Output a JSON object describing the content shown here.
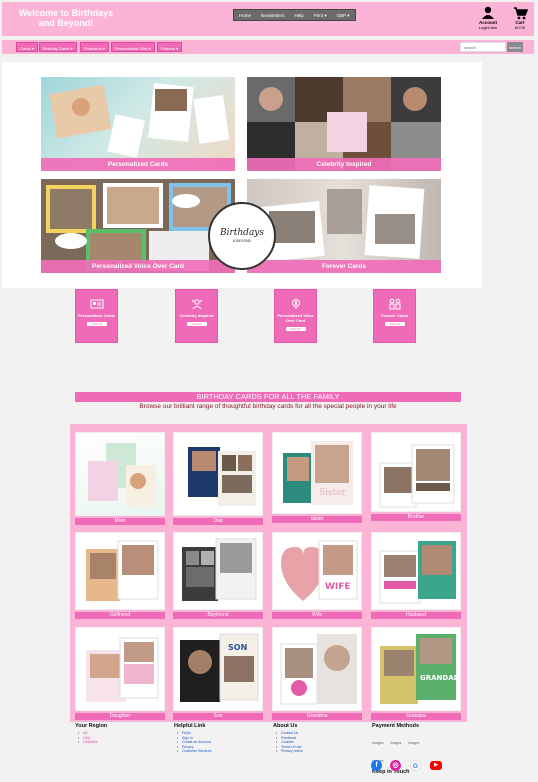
{
  "header": {
    "welcome": "Welcome to Birthdays and Beyond!",
    "topnav": [
      "Home",
      "Newsletters",
      "Help",
      "Print",
      "GBP"
    ],
    "account_label": "Account",
    "account_sub": "Login/Join",
    "cart_label": "Cart",
    "cart_sub": "£0.00"
  },
  "navbar": {
    "items": [
      "Cards",
      "Birthday Cards",
      "Postcards",
      "Personalised Gifts",
      "Flowers"
    ],
    "search_placeholder": "search",
    "search_button": "search"
  },
  "hero": {
    "tiles": [
      "Personalized Cards",
      "Celebrity Inspired",
      "Personalized Voice Over Card",
      "Forever Cards"
    ],
    "logo_main": "Birthdays",
    "logo_sub": "& BEYOND"
  },
  "categories": [
    {
      "title": "Personalized Cards",
      "button": "View All",
      "icon": "id-card-icon"
    },
    {
      "title": "Celebrity Inspired",
      "button": "View All",
      "icon": "celebrity-icon"
    },
    {
      "title": "Personalized Voice Over Card",
      "button": "View All",
      "icon": "voice-icon"
    },
    {
      "title": "Forever Cards",
      "button": "View All",
      "icon": "family-icon"
    }
  ],
  "family": {
    "title": "BIRTHDAY CARDS FOR ALL THE FAMILY",
    "subtitle": "Browse our brilliant range of thoughtful birthday cards for all the special people in your life",
    "cards": [
      "Mom",
      "Dad",
      "Sister",
      "Brother",
      "Girlfriend",
      "Boyfriend",
      "Wife",
      "Husband",
      "Daughter",
      "Son",
      "Grandma",
      "Grandpa"
    ]
  },
  "footer": {
    "region_title": "Your Region",
    "regions": [
      "UK",
      "USA",
      "CANADA"
    ],
    "helpful_title": "Helpful Link",
    "helpful": [
      "FAQs",
      "Sign In",
      "Create an Account",
      "Privacy",
      "Customer Services"
    ],
    "about_title": "About Us",
    "about": [
      "Contact Us",
      "Feedback",
      "Cookies",
      "Terms of Use",
      "Privacy notice"
    ],
    "payment_title": "Payment Methods",
    "payment_images": [
      "Images",
      "Images",
      "Images",
      "Images"
    ],
    "keep_title": "Keep in Touch",
    "social": [
      "facebook-icon",
      "instagram-icon",
      "google-icon",
      "youtube-icon"
    ]
  },
  "colors": {
    "pink_light": "#fbb3d6",
    "pink_strong": "#f06bb7",
    "dark_red_text": "#8a1a2e",
    "link_blue": "#1a56c4"
  }
}
